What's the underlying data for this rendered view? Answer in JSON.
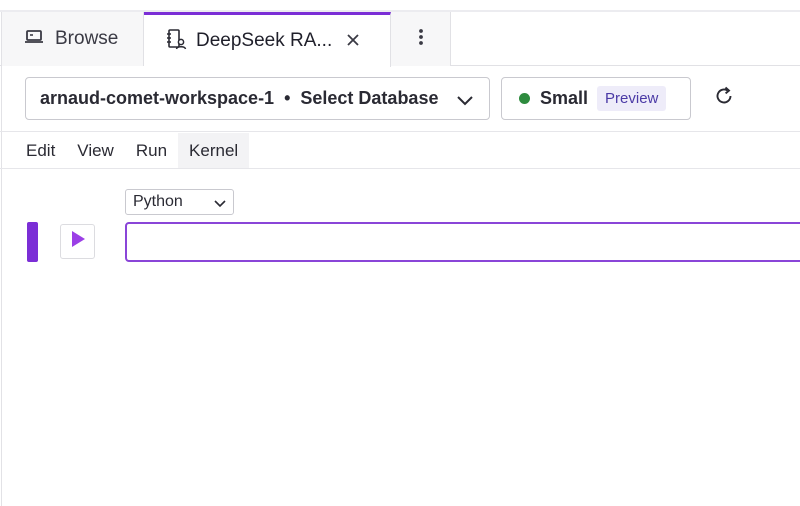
{
  "tabs": [
    {
      "label": "Browse",
      "icon": "laptop-icon"
    },
    {
      "label": "DeepSeek RA...",
      "icon": "notebook-icon"
    }
  ],
  "workspace": {
    "name": "arnaud-comet-workspace-1",
    "separator": "•",
    "database": "Select Database"
  },
  "warehouse": {
    "size": "Small",
    "badge": "Preview",
    "status_color": "#2e8b3e"
  },
  "menu": [
    "Edit",
    "View",
    "Run",
    "Kernel"
  ],
  "cell": {
    "language": "Python",
    "code": ""
  },
  "colors": {
    "accent": "#7b2ed6"
  }
}
